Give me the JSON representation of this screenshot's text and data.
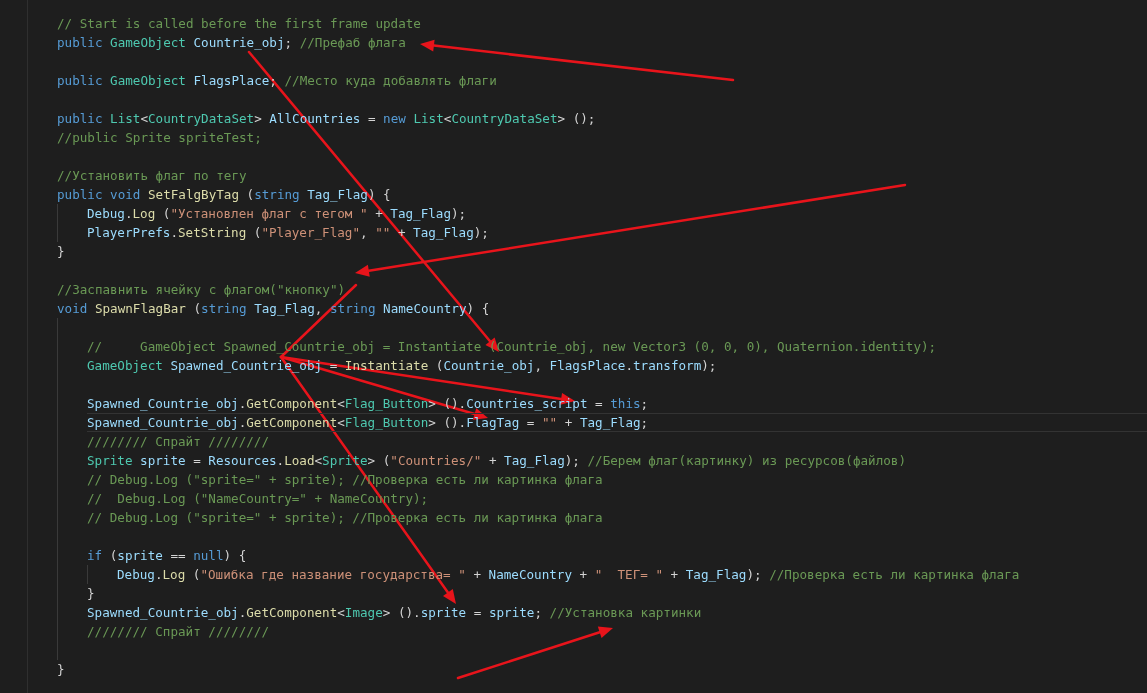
{
  "editor": {
    "lines": [
      {
        "current": false,
        "tokens": [
          {
            "kind": "comment",
            "text": "// Start is called before the first frame update"
          }
        ]
      },
      {
        "current": false,
        "tokens": [
          {
            "kind": "keyword",
            "text": "public "
          },
          {
            "kind": "type",
            "text": "GameObject "
          },
          {
            "kind": "variable",
            "text": "Countrie_obj"
          },
          {
            "kind": "plain",
            "text": "; "
          },
          {
            "kind": "comment",
            "text": "//Префаб флага"
          }
        ]
      },
      {
        "current": false
      },
      {
        "current": false,
        "tokens": [
          {
            "kind": "keyword",
            "text": "public "
          },
          {
            "kind": "type",
            "text": "GameObject "
          },
          {
            "kind": "variable",
            "text": "FlagsPlace"
          },
          {
            "kind": "plain",
            "text": "; "
          },
          {
            "kind": "comment",
            "text": "//Место куда добавлять флаги"
          }
        ]
      },
      {
        "current": false
      },
      {
        "current": false,
        "tokens": [
          {
            "kind": "keyword",
            "text": "public "
          },
          {
            "kind": "type",
            "text": "List"
          },
          {
            "kind": "plain",
            "text": "<"
          },
          {
            "kind": "type",
            "text": "CountryDataSet"
          },
          {
            "kind": "plain",
            "text": "> "
          },
          {
            "kind": "variable",
            "text": "AllCountries"
          },
          {
            "kind": "plain",
            "text": " = "
          },
          {
            "kind": "keyword",
            "text": "new "
          },
          {
            "kind": "type",
            "text": "List"
          },
          {
            "kind": "plain",
            "text": "<"
          },
          {
            "kind": "type",
            "text": "CountryDataSet"
          },
          {
            "kind": "plain",
            "text": "> ();"
          }
        ]
      },
      {
        "current": false,
        "tokens": [
          {
            "kind": "comment",
            "text": "//public Sprite spriteTest;"
          }
        ]
      },
      {
        "current": false
      },
      {
        "current": false,
        "tokens": [
          {
            "kind": "comment",
            "text": "//Установить флаг по тегу"
          }
        ]
      },
      {
        "current": false,
        "tokens": [
          {
            "kind": "keyword",
            "text": "public void "
          },
          {
            "kind": "function",
            "text": "SetFalgByTag"
          },
          {
            "kind": "plain",
            "text": " ("
          },
          {
            "kind": "keyword",
            "text": "string "
          },
          {
            "kind": "variable",
            "text": "Tag_Flag"
          },
          {
            "kind": "plain",
            "text": ") {"
          }
        ],
        "children": [
          {
            "current": false,
            "tokens": [
              {
                "kind": "variable",
                "text": "Debug"
              },
              {
                "kind": "plain",
                "text": "."
              },
              {
                "kind": "function",
                "text": "Log"
              },
              {
                "kind": "plain",
                "text": " ("
              },
              {
                "kind": "string",
                "text": "\"Установлен флаг с тегом \""
              },
              {
                "kind": "plain",
                "text": " + "
              },
              {
                "kind": "variable",
                "text": "Tag_Flag"
              },
              {
                "kind": "plain",
                "text": ");"
              }
            ]
          },
          {
            "current": false,
            "tokens": [
              {
                "kind": "variable",
                "text": "PlayerPrefs"
              },
              {
                "kind": "plain",
                "text": "."
              },
              {
                "kind": "function",
                "text": "SetString"
              },
              {
                "kind": "plain",
                "text": " ("
              },
              {
                "kind": "string",
                "text": "\"Player_Flag\""
              },
              {
                "kind": "plain",
                "text": ", "
              },
              {
                "kind": "string",
                "text": "\"\""
              },
              {
                "kind": "plain",
                "text": " + "
              },
              {
                "kind": "variable",
                "text": "Tag_Flag"
              },
              {
                "kind": "plain",
                "text": ");"
              }
            ]
          }
        ]
      },
      {
        "current": false,
        "tokens": [
          {
            "kind": "plain",
            "text": "}"
          }
        ]
      },
      {
        "current": false
      },
      {
        "current": false,
        "tokens": [
          {
            "kind": "comment",
            "text": "//Заспавнить ячейку с флагом(\"кнопку\")"
          }
        ]
      },
      {
        "current": false,
        "tokens": [
          {
            "kind": "keyword",
            "text": "void "
          },
          {
            "kind": "function",
            "text": "SpawnFlagBar"
          },
          {
            "kind": "plain",
            "text": " ("
          },
          {
            "kind": "keyword",
            "text": "string "
          },
          {
            "kind": "variable",
            "text": "Tag_Flag"
          },
          {
            "kind": "plain",
            "text": ", "
          },
          {
            "kind": "keyword",
            "text": "string "
          },
          {
            "kind": "variable",
            "text": "NameCountry"
          },
          {
            "kind": "plain",
            "text": ") {"
          }
        ],
        "children": [
          {
            "current": false
          },
          {
            "current": false,
            "tokens": [
              {
                "kind": "comment",
                "text": "//     GameObject Spawned_Countrie_obj = Instantiate (Countrie_obj, new Vector3 (0, 0, 0), Quaternion.identity);"
              }
            ]
          },
          {
            "current": false,
            "tokens": [
              {
                "kind": "type",
                "text": "GameObject "
              },
              {
                "kind": "variable",
                "text": "Spawned_Countrie_obj"
              },
              {
                "kind": "plain",
                "text": " = "
              },
              {
                "kind": "function",
                "text": "Instantiate"
              },
              {
                "kind": "plain",
                "text": " ("
              },
              {
                "kind": "variable",
                "text": "Countrie_obj"
              },
              {
                "kind": "plain",
                "text": ", "
              },
              {
                "kind": "variable",
                "text": "FlagsPlace"
              },
              {
                "kind": "plain",
                "text": "."
              },
              {
                "kind": "variable",
                "text": "transform"
              },
              {
                "kind": "plain",
                "text": ");"
              }
            ]
          },
          {
            "current": false
          },
          {
            "current": false,
            "tokens": [
              {
                "kind": "variable",
                "text": "Spawned_Countrie_obj"
              },
              {
                "kind": "plain",
                "text": "."
              },
              {
                "kind": "function",
                "text": "GetComponent"
              },
              {
                "kind": "plain",
                "text": "<"
              },
              {
                "kind": "type",
                "text": "Flag_Button"
              },
              {
                "kind": "plain",
                "text": "> ()."
              },
              {
                "kind": "variable",
                "text": "Countries_script"
              },
              {
                "kind": "plain",
                "text": " = "
              },
              {
                "kind": "keyword",
                "text": "this"
              },
              {
                "kind": "plain",
                "text": ";"
              }
            ]
          },
          {
            "current": true,
            "tokens": [
              {
                "kind": "variable",
                "text": "Spawned_Countrie_obj"
              },
              {
                "kind": "plain",
                "text": "."
              },
              {
                "kind": "function",
                "text": "GetComponent"
              },
              {
                "kind": "plain",
                "text": "<"
              },
              {
                "kind": "type",
                "text": "Flag_Button"
              },
              {
                "kind": "plain",
                "text": "> ()."
              },
              {
                "kind": "variable",
                "text": "FlagTag"
              },
              {
                "kind": "plain",
                "text": " = "
              },
              {
                "kind": "string",
                "text": "\"\""
              },
              {
                "kind": "plain",
                "text": " + "
              },
              {
                "kind": "variable",
                "text": "Tag_Flag"
              },
              {
                "kind": "plain",
                "text": ";"
              }
            ]
          },
          {
            "current": false,
            "tokens": [
              {
                "kind": "comment",
                "text": "//////// Спрайт ////////"
              }
            ]
          },
          {
            "current": false,
            "tokens": [
              {
                "kind": "type",
                "text": "Sprite "
              },
              {
                "kind": "variable",
                "text": "sprite"
              },
              {
                "kind": "plain",
                "text": " = "
              },
              {
                "kind": "variable",
                "text": "Resources"
              },
              {
                "kind": "plain",
                "text": "."
              },
              {
                "kind": "function",
                "text": "Load"
              },
              {
                "kind": "plain",
                "text": "<"
              },
              {
                "kind": "type",
                "text": "Sprite"
              },
              {
                "kind": "plain",
                "text": "> ("
              },
              {
                "kind": "string",
                "text": "\"Countries/\""
              },
              {
                "kind": "plain",
                "text": " + "
              },
              {
                "kind": "variable",
                "text": "Tag_Flag"
              },
              {
                "kind": "plain",
                "text": "); "
              },
              {
                "kind": "comment",
                "text": "//Берем флаг(картинку) из ресурсов(файлов)"
              }
            ]
          },
          {
            "current": false,
            "tokens": [
              {
                "kind": "comment",
                "text": "// Debug.Log (\"sprite=\" + sprite); //Проверка есть ли картинка флага"
              }
            ]
          },
          {
            "current": false,
            "tokens": [
              {
                "kind": "comment",
                "text": "//  Debug.Log (\"NameCountry=\" + NameCountry);"
              }
            ]
          },
          {
            "current": false,
            "tokens": [
              {
                "kind": "comment",
                "text": "// Debug.Log (\"sprite=\" + sprite); //Проверка есть ли картинка флага"
              }
            ]
          },
          {
            "current": false
          },
          {
            "current": false,
            "tokens": [
              {
                "kind": "keyword",
                "text": "if"
              },
              {
                "kind": "plain",
                "text": " ("
              },
              {
                "kind": "variable",
                "text": "sprite"
              },
              {
                "kind": "plain",
                "text": " == "
              },
              {
                "kind": "keyword",
                "text": "null"
              },
              {
                "kind": "plain",
                "text": ") {"
              }
            ],
            "children": [
              {
                "current": false,
                "tokens": [
                  {
                    "kind": "variable",
                    "text": "Debug"
                  },
                  {
                    "kind": "plain",
                    "text": "."
                  },
                  {
                    "kind": "function",
                    "text": "Log"
                  },
                  {
                    "kind": "plain",
                    "text": " ("
                  },
                  {
                    "kind": "string",
                    "text": "\"Ошибка где название государства= \""
                  },
                  {
                    "kind": "plain",
                    "text": " + "
                  },
                  {
                    "kind": "variable",
                    "text": "NameCountry"
                  },
                  {
                    "kind": "plain",
                    "text": " + "
                  },
                  {
                    "kind": "string",
                    "text": "\"  ТЕГ= \""
                  },
                  {
                    "kind": "plain",
                    "text": " + "
                  },
                  {
                    "kind": "variable",
                    "text": "Tag_Flag"
                  },
                  {
                    "kind": "plain",
                    "text": "); "
                  },
                  {
                    "kind": "comment",
                    "text": "//Проверка есть ли картинка флага"
                  }
                ]
              }
            ]
          },
          {
            "current": false,
            "tokens": [
              {
                "kind": "plain",
                "text": "}"
              }
            ]
          },
          {
            "current": false,
            "tokens": [
              {
                "kind": "variable",
                "text": "Spawned_Countrie_obj"
              },
              {
                "kind": "plain",
                "text": "."
              },
              {
                "kind": "function",
                "text": "GetComponent"
              },
              {
                "kind": "plain",
                "text": "<"
              },
              {
                "kind": "type",
                "text": "Image"
              },
              {
                "kind": "plain",
                "text": "> ()."
              },
              {
                "kind": "variable",
                "text": "sprite"
              },
              {
                "kind": "plain",
                "text": " = "
              },
              {
                "kind": "variable",
                "text": "sprite"
              },
              {
                "kind": "plain",
                "text": "; "
              },
              {
                "kind": "comment",
                "text": "//Установка картинки"
              }
            ]
          },
          {
            "current": false,
            "tokens": [
              {
                "kind": "comment",
                "text": "//////// Спрайт ////////"
              }
            ]
          },
          {
            "current": false
          }
        ]
      },
      {
        "current": false,
        "tokens": [
          {
            "kind": "plain",
            "text": "}"
          }
        ]
      }
    ]
  }
}
